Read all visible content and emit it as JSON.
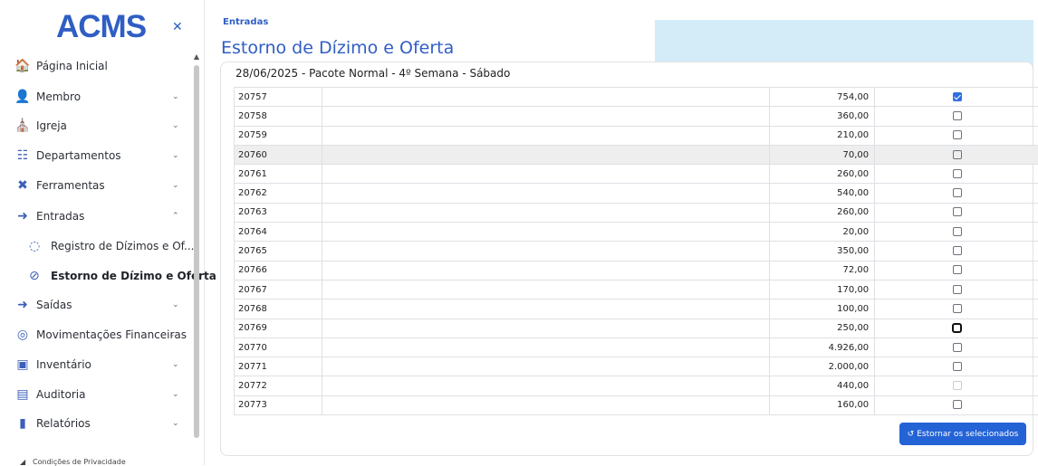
{
  "app": {
    "logo": "ACMS"
  },
  "sidebar": {
    "items": [
      {
        "label": "Página Inicial",
        "icon": "home-icon",
        "glyph": "🏠"
      },
      {
        "label": "Membro",
        "icon": "user-icon",
        "glyph": "👤"
      },
      {
        "label": "Igreja",
        "icon": "church-icon",
        "glyph": "⛪"
      },
      {
        "label": "Departamentos",
        "icon": "sitemap-icon",
        "glyph": "☷"
      },
      {
        "label": "Ferramentas",
        "icon": "tools-icon",
        "glyph": "✖"
      },
      {
        "label": "Entradas",
        "icon": "sign-in-icon",
        "glyph": "➜"
      },
      {
        "label": "Saídas",
        "icon": "sign-out-icon",
        "glyph": "➜"
      },
      {
        "label": "Movimentações Financeiras",
        "icon": "coins-icon",
        "glyph": "◎"
      },
      {
        "label": "Inventário",
        "icon": "inventory-icon",
        "glyph": "▣"
      },
      {
        "label": "Auditoria",
        "icon": "audit-icon",
        "glyph": "▤"
      },
      {
        "label": "Relatórios",
        "icon": "chart-icon",
        "glyph": "▮"
      }
    ],
    "subitems": [
      {
        "label": "Registro de Dízimos e Of...",
        "icon": "hand-money-icon",
        "glyph": "◌"
      },
      {
        "label": "Estorno de Dízimo e Oferta",
        "icon": "ban-icon",
        "glyph": "⊘"
      }
    ],
    "privacy": "Condições de Privacidade"
  },
  "main": {
    "breadcrumb": "Entradas",
    "title": "Estorno de Dízimo e Oferta",
    "pacote": "28/06/2025 - Pacote Normal - 4º Semana - Sábado",
    "button_label": "Estornar os selecionados",
    "rows": [
      {
        "id": "20757",
        "value": "754,00",
        "state": "on"
      },
      {
        "id": "20758",
        "value": "360,00",
        "state": "off"
      },
      {
        "id": "20759",
        "value": "210,00",
        "state": "off"
      },
      {
        "id": "20760",
        "value": "70,00",
        "state": "off"
      },
      {
        "id": "20761",
        "value": "260,00",
        "state": "off"
      },
      {
        "id": "20762",
        "value": "540,00",
        "state": "off"
      },
      {
        "id": "20763",
        "value": "260,00",
        "state": "off"
      },
      {
        "id": "20764",
        "value": "20,00",
        "state": "off"
      },
      {
        "id": "20765",
        "value": "350,00",
        "state": "off"
      },
      {
        "id": "20766",
        "value": "72,00",
        "state": "off"
      },
      {
        "id": "20767",
        "value": "170,00",
        "state": "off"
      },
      {
        "id": "20768",
        "value": "100,00",
        "state": "off"
      },
      {
        "id": "20769",
        "value": "250,00",
        "state": "focus"
      },
      {
        "id": "20770",
        "value": "4.926,00",
        "state": "off"
      },
      {
        "id": "20771",
        "value": "2.000,00",
        "state": "off"
      },
      {
        "id": "20772",
        "value": "440,00",
        "state": "disabled"
      },
      {
        "id": "20773",
        "value": "160,00",
        "state": "off"
      }
    ]
  },
  "colors": {
    "accent": "#2f5ec4",
    "button": "#2463d6",
    "notice": "#d4ecf8"
  }
}
